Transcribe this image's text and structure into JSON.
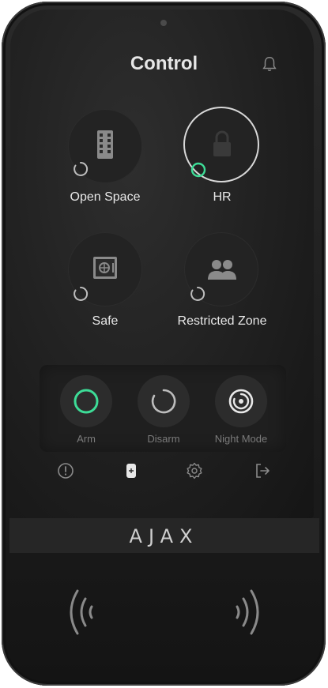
{
  "header": {
    "title": "Control",
    "notification_icon": "bell-icon"
  },
  "groups": [
    {
      "label": "Open Space",
      "icon": "building-icon",
      "status": "disarmed"
    },
    {
      "label": "HR",
      "icon": "lock-icon",
      "status": "armed",
      "selected": true
    },
    {
      "label": "Safe",
      "icon": "safe-icon",
      "status": "disarmed"
    },
    {
      "label": "Restricted Zone",
      "icon": "people-icon",
      "status": "disarmed"
    }
  ],
  "modes": {
    "arm": {
      "label": "Arm",
      "icon": "ring-icon"
    },
    "disarm": {
      "label": "Disarm",
      "icon": "open-ring-icon"
    },
    "night": {
      "label": "Night Mode",
      "icon": "night-mode-icon"
    }
  },
  "nav": [
    "alert-icon",
    "keypad-icon",
    "settings-icon",
    "logout-icon"
  ],
  "brand": {
    "logo": "AJAX"
  },
  "colors": {
    "accent_green": "#3ddc97",
    "text": "#e8e8e8",
    "muted": "#7a7a7a"
  }
}
